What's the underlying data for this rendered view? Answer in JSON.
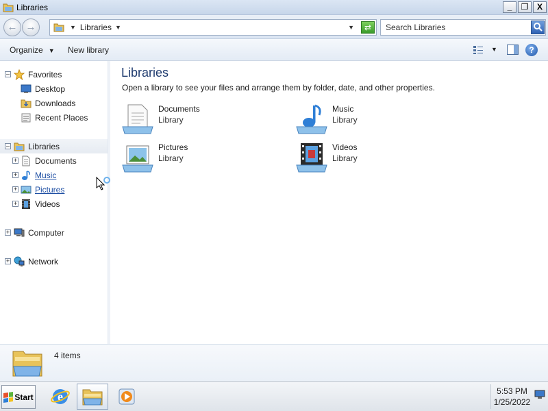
{
  "window": {
    "title": "Libraries",
    "icon": "libraries-folder-icon"
  },
  "window_controls": {
    "minimize": "_",
    "maximize": "❐",
    "close": "X"
  },
  "address_bar": {
    "breadcrumb": "Libraries",
    "search_placeholder": "Search Libraries"
  },
  "toolbar": {
    "organize": "Organize",
    "new_library": "New library",
    "help": "?"
  },
  "nav_pane": {
    "favorites": {
      "label": "Favorites",
      "items": [
        "Desktop",
        "Downloads",
        "Recent Places"
      ]
    },
    "libraries": {
      "label": "Libraries",
      "items": [
        "Documents",
        "Music",
        "Pictures",
        "Videos"
      ]
    },
    "computer": "Computer",
    "network": "Network"
  },
  "content": {
    "title": "Libraries",
    "subtitle": "Open a library to see your files and arrange them by folder, date, and other properties.",
    "libraries": [
      {
        "name": "Documents",
        "type": "Library",
        "icon": "documents-library-icon"
      },
      {
        "name": "Music",
        "type": "Library",
        "icon": "music-library-icon"
      },
      {
        "name": "Pictures",
        "type": "Library",
        "icon": "pictures-library-icon"
      },
      {
        "name": "Videos",
        "type": "Library",
        "icon": "videos-library-icon"
      }
    ]
  },
  "details_pane": {
    "item_count": "4 items"
  },
  "taskbar": {
    "start": "Start",
    "apps": [
      "internet-explorer-icon",
      "windows-explorer-icon",
      "media-player-icon"
    ],
    "time": "5:53 PM",
    "date": "1/25/2022"
  },
  "colors": {
    "title_text": "#1e3a6e",
    "link": "#1d4ea3"
  }
}
